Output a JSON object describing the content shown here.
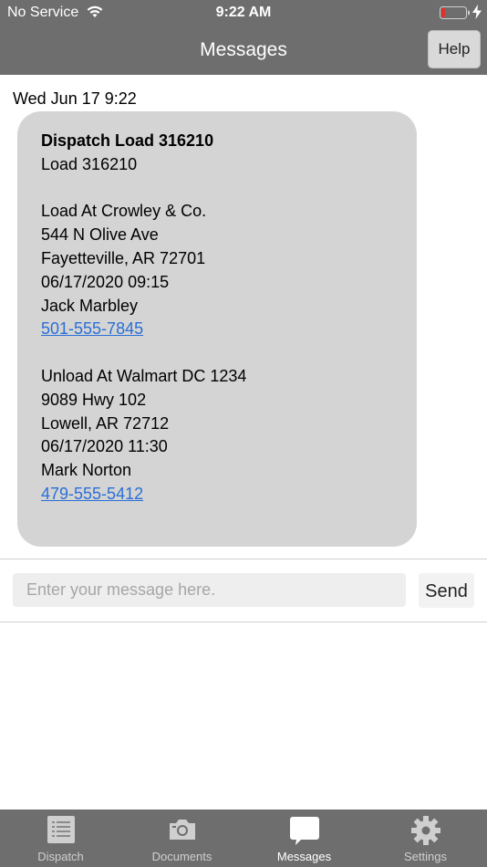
{
  "status_bar": {
    "carrier": "No Service",
    "time": "9:22 AM",
    "wifi_icon": "wifi-icon",
    "battery_icon": "battery-low-icon",
    "charging_icon": "lightning-bolt-icon"
  },
  "nav": {
    "title": "Messages",
    "help_label": "Help"
  },
  "message": {
    "date": "Wed Jun 17 9:22",
    "title": "Dispatch Load 316210",
    "load_line": "Load 316210",
    "pickup": {
      "location": "Load At Crowley & Co.",
      "street": "544 N Olive Ave",
      "city": "Fayetteville, AR 72701",
      "datetime": "06/17/2020 09:15",
      "contact": "Jack Marbley",
      "phone": "501-555-7845"
    },
    "dropoff": {
      "location": "Unload At Walmart DC 1234",
      "street": "9089 Hwy 102",
      "city": "Lowell, AR 72712",
      "datetime": "06/17/2020 11:30",
      "contact": "Mark Norton",
      "phone": "479-555-5412"
    }
  },
  "composer": {
    "placeholder": "Enter your message here.",
    "value": "",
    "send_label": "Send"
  },
  "tabs": [
    {
      "label": "Dispatch",
      "icon": "list-icon",
      "active": false
    },
    {
      "label": "Documents",
      "icon": "camera-icon",
      "active": false
    },
    {
      "label": "Messages",
      "icon": "speech-bubble-icon",
      "active": true
    },
    {
      "label": "Settings",
      "icon": "gear-icon",
      "active": false
    }
  ],
  "colors": {
    "bar_gray": "#6e6e6e",
    "bubble_gray": "#d4d4d4",
    "link_blue": "#2a6fd6",
    "tab_inactive": "#cfcfcf",
    "tab_active": "#ffffff"
  }
}
